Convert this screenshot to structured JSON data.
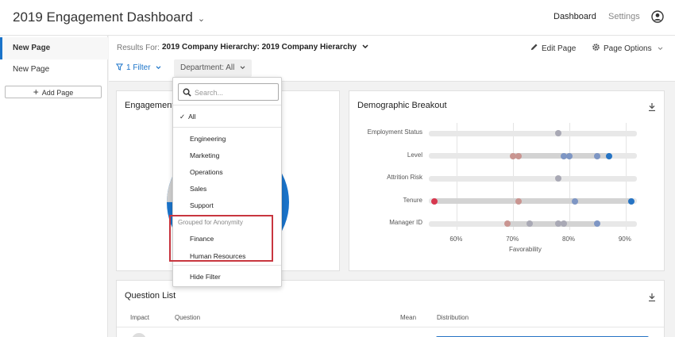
{
  "header": {
    "title": "2019 Engagement Dashboard",
    "title_chevron": "⌄",
    "nav_dashboard": "Dashboard",
    "nav_settings": "Settings"
  },
  "sidebar": {
    "items": [
      {
        "label": "New Page",
        "active": true
      },
      {
        "label": "New Page",
        "active": false
      }
    ],
    "add_page_label": "Add Page"
  },
  "subheader": {
    "results_for_label": "Results For:",
    "results_value": "2019 Company Hierarchy: 2019 Company Hierarchy",
    "edit_page_label": "Edit Page",
    "page_options_label": "Page Options",
    "filter_label": "1 Filter",
    "department_label": "Department: All"
  },
  "cards": {
    "engagement_title": "Engagement",
    "demographic_title": "Demographic Breakout",
    "question_list_title": "Question List"
  },
  "dropdown": {
    "search_placeholder": "Search...",
    "all_label": "All",
    "items": [
      "Engineering",
      "Marketing",
      "Operations",
      "Sales",
      "Support"
    ],
    "group_label": "Grouped for Anonymity",
    "group_items": [
      "Finance",
      "Human Resources"
    ],
    "hide_filter_label": "Hide Filter"
  },
  "colors": {
    "accent": "#1a73c9",
    "highlight": "#c8363f",
    "dot_red": "#d7384f",
    "dot_pink": "#c99591",
    "dot_gray": "#a9a9b5",
    "dot_blue_light": "#7e96c4",
    "dot_blue": "#2674c4"
  },
  "question_list": {
    "columns": [
      "Impact",
      "Question",
      "Mean",
      "Distribution"
    ]
  },
  "chart_data": {
    "type": "scatter",
    "title": "Demographic Breakout",
    "xlabel": "Favorability",
    "xlim": [
      55,
      92
    ],
    "ticks": [
      {
        "value": 60,
        "label": "60%"
      },
      {
        "value": 70,
        "label": "70%"
      },
      {
        "value": 80,
        "label": "80%"
      },
      {
        "value": 90,
        "label": "90%"
      }
    ],
    "rows": [
      {
        "label": "Employment Status",
        "range": [
          78,
          78
        ],
        "points": [
          {
            "x": 78,
            "color": "#a9a9b5"
          }
        ]
      },
      {
        "label": "Level",
        "range": [
          70,
          87
        ],
        "points": [
          {
            "x": 70,
            "color": "#c99591"
          },
          {
            "x": 71,
            "color": "#c99591"
          },
          {
            "x": 79,
            "color": "#7e96c4"
          },
          {
            "x": 80,
            "color": "#7e96c4"
          },
          {
            "x": 85,
            "color": "#7e96c4"
          },
          {
            "x": 87,
            "color": "#2674c4"
          }
        ]
      },
      {
        "label": "Attrition Risk",
        "range": [
          78,
          78
        ],
        "points": [
          {
            "x": 78,
            "color": "#a9a9b5"
          }
        ]
      },
      {
        "label": "Tenure",
        "range": [
          56,
          91
        ],
        "points": [
          {
            "x": 56,
            "color": "#d7384f"
          },
          {
            "x": 71,
            "color": "#c99591"
          },
          {
            "x": 81,
            "color": "#7e96c4"
          },
          {
            "x": 91,
            "color": "#2674c4"
          }
        ]
      },
      {
        "label": "Manager ID",
        "range": [
          69,
          85
        ],
        "points": [
          {
            "x": 69,
            "color": "#c99591"
          },
          {
            "x": 73,
            "color": "#a9a9b5"
          },
          {
            "x": 78,
            "color": "#a9a9b5"
          },
          {
            "x": 79,
            "color": "#a9a9b5"
          },
          {
            "x": 85,
            "color": "#7e96c4"
          }
        ]
      }
    ]
  }
}
